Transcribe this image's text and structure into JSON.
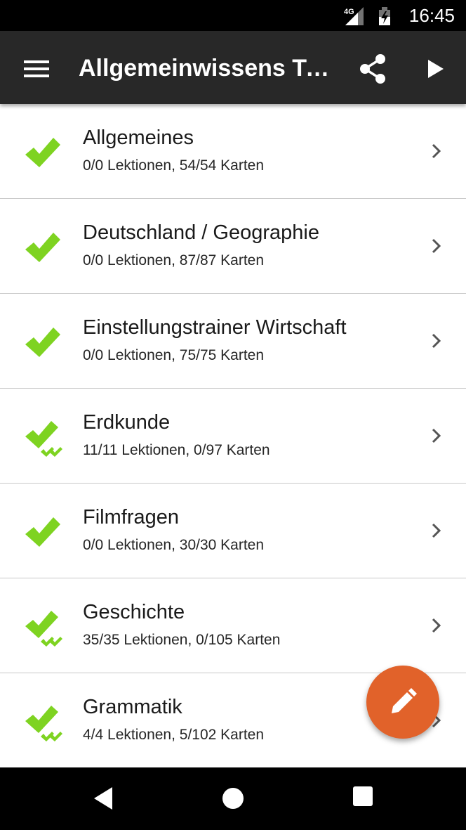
{
  "status_bar": {
    "time": "16:45",
    "network": "4G",
    "icons": [
      "signal-icon",
      "battery-icon"
    ]
  },
  "app_bar": {
    "title": "Allgemeinwissens Trainer",
    "icons": [
      "menu-icon",
      "share-icon",
      "play-icon"
    ]
  },
  "courses": [
    {
      "title": "Allgemeines",
      "subtitle": "0/0 Lektionen, 54/54 Karten",
      "status": "single"
    },
    {
      "title": "Deutschland / Geographie",
      "subtitle": "0/0 Lektionen, 87/87 Karten",
      "status": "single"
    },
    {
      "title": "Einstellungstrainer Wirtschaft",
      "subtitle": "0/0 Lektionen, 75/75 Karten",
      "status": "single"
    },
    {
      "title": "Erdkunde",
      "subtitle": "11/11 Lektionen, 0/97 Karten",
      "status": "double"
    },
    {
      "title": "Filmfragen",
      "subtitle": "0/0 Lektionen, 30/30 Karten",
      "status": "single"
    },
    {
      "title": "Geschichte",
      "subtitle": "35/35 Lektionen, 0/105 Karten",
      "status": "double"
    },
    {
      "title": "Grammatik",
      "subtitle": "4/4 Lektionen, 5/102 Karten",
      "status": "double"
    }
  ],
  "fab": {
    "icon": "pencil-icon"
  },
  "nav_bar": {
    "icons": [
      "back-icon",
      "home-icon",
      "recents-icon"
    ]
  },
  "colors": {
    "app_bar": "#282828",
    "check_green": "#7ed321",
    "fab": "#e1622a",
    "divider": "#c8c8c8"
  }
}
